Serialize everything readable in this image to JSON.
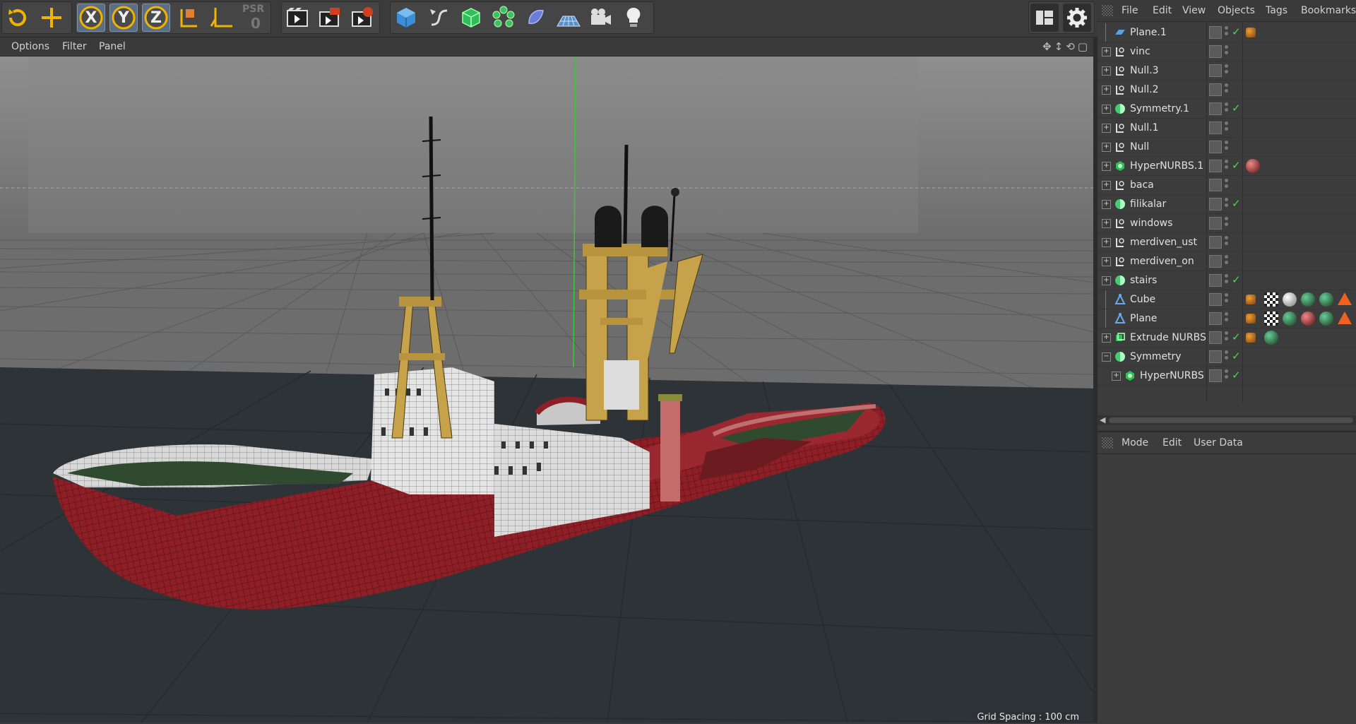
{
  "toolbar": {
    "psr_label": "PSR",
    "psr_value": "0",
    "axis_x": "X",
    "axis_y": "Y",
    "axis_z": "Z"
  },
  "viewport": {
    "menu": [
      "Options",
      "Filter",
      "Panel"
    ],
    "grid_spacing": "Grid Spacing : 100 cm"
  },
  "object_manager": {
    "menu": [
      "File",
      "Edit",
      "View",
      "Objects",
      "Tags",
      "Bookmarks"
    ],
    "objects": [
      {
        "name": "Plane.1",
        "icon": "plane-icon",
        "check": true,
        "expander": "none"
      },
      {
        "name": "vinc",
        "icon": "null-icon",
        "check": false,
        "expander": "plus"
      },
      {
        "name": "Null.3",
        "icon": "null-icon",
        "check": false,
        "expander": "plus"
      },
      {
        "name": "Null.2",
        "icon": "null-icon",
        "check": false,
        "expander": "plus"
      },
      {
        "name": "Symmetry.1",
        "icon": "symmetry-icon",
        "check": true,
        "expander": "plus"
      },
      {
        "name": "Null.1",
        "icon": "null-icon",
        "check": false,
        "expander": "plus"
      },
      {
        "name": "Null",
        "icon": "null-icon",
        "check": false,
        "expander": "plus"
      },
      {
        "name": "HyperNURBS.1",
        "icon": "hypernurbs-icon",
        "check": true,
        "expander": "plus"
      },
      {
        "name": "baca",
        "icon": "null-icon",
        "check": false,
        "expander": "plus"
      },
      {
        "name": "filikalar",
        "icon": "symmetry-icon",
        "check": true,
        "expander": "plus"
      },
      {
        "name": "windows",
        "icon": "null-icon",
        "check": false,
        "expander": "plus"
      },
      {
        "name": "merdiven_ust",
        "icon": "null-icon",
        "check": false,
        "expander": "plus"
      },
      {
        "name": "merdiven_on",
        "icon": "null-icon",
        "check": false,
        "expander": "plus"
      },
      {
        "name": "stairs",
        "icon": "symmetry-icon",
        "check": true,
        "expander": "plus"
      },
      {
        "name": "Cube",
        "icon": "polygon-icon",
        "check": false,
        "expander": "none"
      },
      {
        "name": "Plane",
        "icon": "polygon-icon",
        "check": false,
        "expander": "none"
      },
      {
        "name": "Extrude NURBS",
        "icon": "extrude-icon",
        "check": true,
        "expander": "plus"
      },
      {
        "name": "Symmetry",
        "icon": "symmetry-icon",
        "check": true,
        "expander": "minus"
      },
      {
        "name": "HyperNURBS",
        "icon": "hypernurbs-icon",
        "check": true,
        "expander": "plus",
        "indent": 1
      }
    ]
  },
  "attribute_manager": {
    "menu": [
      "Mode",
      "Edit",
      "User Data"
    ]
  }
}
